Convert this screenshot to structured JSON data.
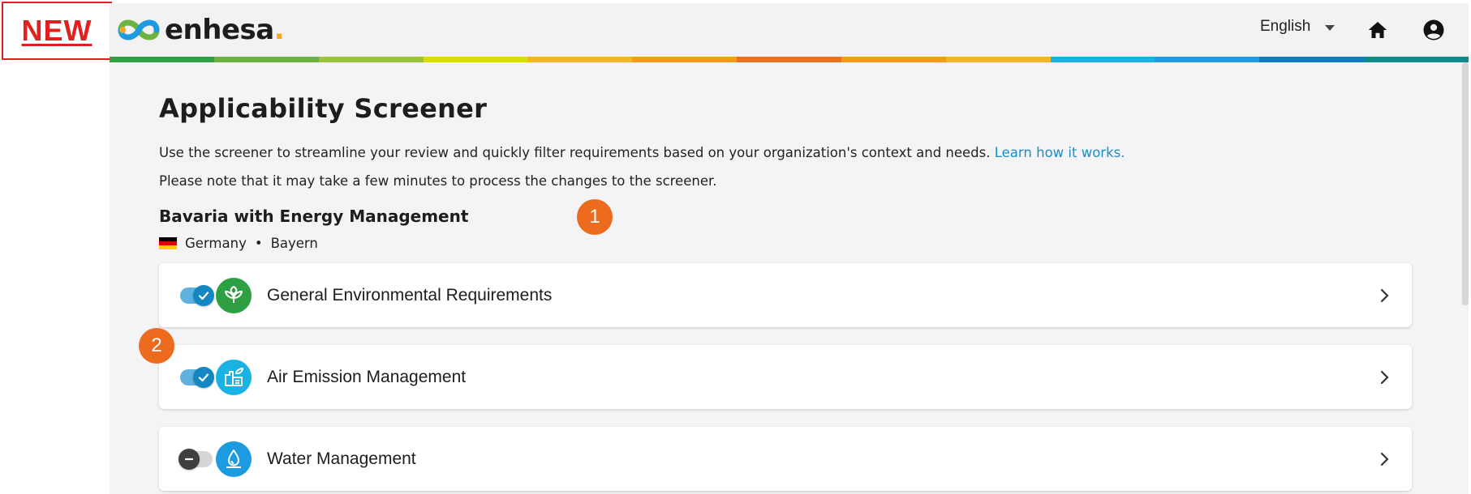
{
  "badge": {
    "label": "NEW"
  },
  "header": {
    "logo_text": "enhesa",
    "logo_dot": ".",
    "language": "English"
  },
  "colors": {
    "rainbow": [
      "#2ea043",
      "#6cb33f",
      "#9cc43a",
      "#d8da1b",
      "#f2b52a",
      "#f39c1a",
      "#ec6f1d",
      "#f39c1a",
      "#f2b52a",
      "#1ab1e3",
      "#1d9be0",
      "#1478c3",
      "#0f8a8a"
    ],
    "accent": "#1a8fc4",
    "step_badge": "#ed6b1f"
  },
  "page": {
    "title": "Applicability Screener",
    "description": "Use the screener to streamline your review and quickly filter requirements based on your organization's context and needs.",
    "learn_link": "Learn how it works.",
    "note": "Please note that it may take a few minutes to process the changes to the screener.",
    "screener_name": "Bavaria with Energy Management",
    "country": "Germany",
    "separator": "•",
    "region": "Bayern"
  },
  "categories": [
    {
      "label": "General Environmental Requirements",
      "enabled": true,
      "icon": "plant-icon",
      "icon_color": "#2ea043"
    },
    {
      "label": "Air Emission Management",
      "enabled": true,
      "icon": "factory-icon",
      "icon_color": "#1ab1e3"
    },
    {
      "label": "Water Management",
      "enabled": false,
      "icon": "water-drop-icon",
      "icon_color": "#1d9be0"
    }
  ],
  "steps": [
    "1",
    "2"
  ]
}
